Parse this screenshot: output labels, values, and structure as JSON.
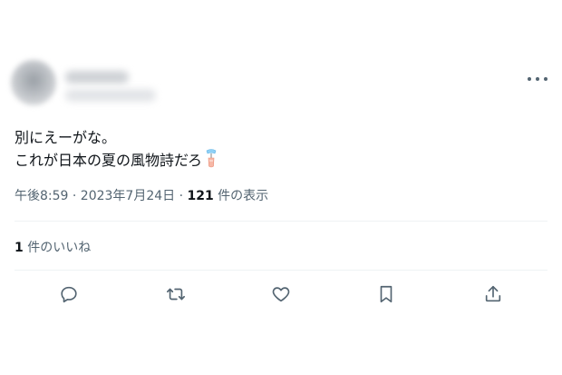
{
  "tweet": {
    "line1": "別にえーがな。",
    "line2": "これが日本の夏の風物詩だろ",
    "timestamp": "午後8:59 · 2023年7月24日 · ",
    "view_count": "121",
    "view_label": " 件の表示",
    "like_count": "1",
    "like_label": " 件のいいね"
  },
  "icons": {
    "more": "more-icon",
    "emoji": "wind-chime-emoji",
    "reply": "reply-icon",
    "retweet": "retweet-icon",
    "like": "heart-icon",
    "bookmark": "bookmark-icon",
    "share": "share-icon"
  },
  "colors": {
    "text": "#0f1419",
    "secondary": "#536471",
    "divider": "#eff3f4"
  }
}
